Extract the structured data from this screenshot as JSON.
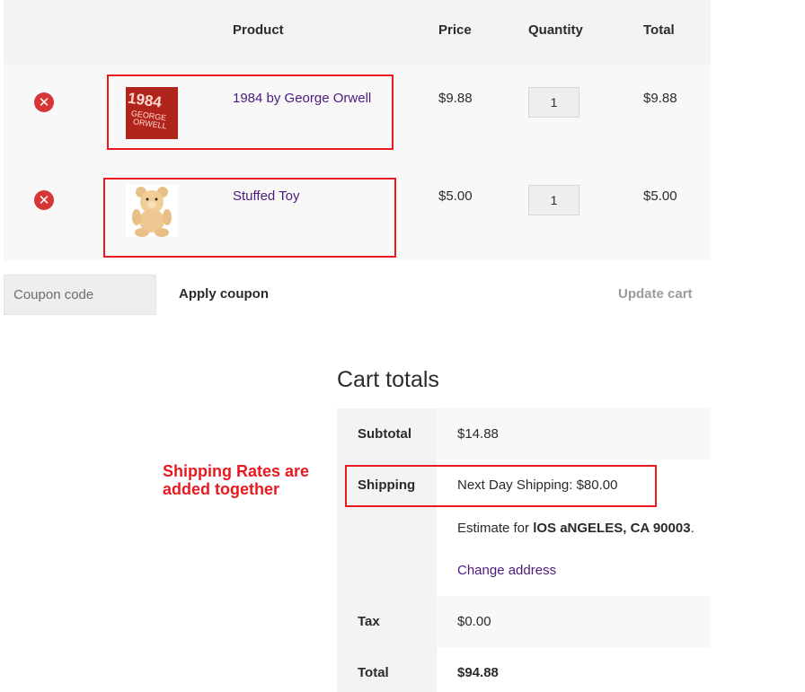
{
  "cart": {
    "headers": {
      "product": "Product",
      "price": "Price",
      "quantity": "Quantity",
      "total": "Total"
    },
    "items": [
      {
        "name": "1984 by George Orwell",
        "price": "$9.88",
        "quantity": "1",
        "total": "$9.88",
        "thumb_text_1": "1984",
        "thumb_text_2": "GEORGE",
        "thumb_text_3": "ORWELL"
      },
      {
        "name": "Stuffed Toy",
        "price": "$5.00",
        "quantity": "1",
        "total": "$5.00"
      }
    ],
    "remove_glyph": "✕",
    "coupon_placeholder": "Coupon code",
    "apply_coupon": "Apply coupon",
    "update_cart": "Update cart"
  },
  "totals": {
    "title": "Cart totals",
    "subtotal_label": "Subtotal",
    "subtotal_value": "$14.88",
    "shipping_label": "Shipping",
    "shipping_value": "Next Day Shipping: $80.00",
    "estimate_prefix": "Estimate for ",
    "estimate_location": "lOS aNGELES, CA 90003",
    "estimate_suffix": ".",
    "change_address": "Change address",
    "tax_label": "Tax",
    "tax_value": "$0.00",
    "total_label": "Total",
    "total_value": "$94.88"
  },
  "annotation": {
    "line1": "Shipping Rates are",
    "line2": "added together"
  },
  "colors": {
    "annotation_red": "#e8191f",
    "link_purple": "#4a1b7a",
    "remove_red": "#d63638"
  },
  "icons": {
    "remove": "remove-circle-x-icon"
  }
}
